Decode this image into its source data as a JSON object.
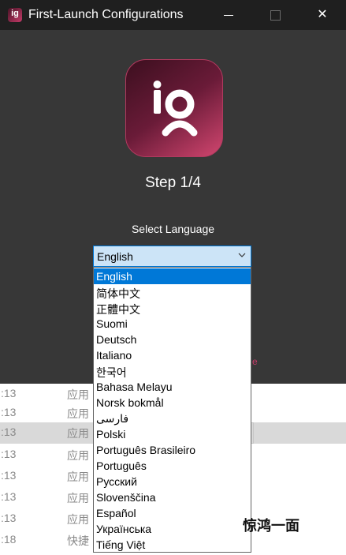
{
  "window": {
    "title": "First-Launch Configurations",
    "app_icon_text": "ig",
    "controls": {
      "minimize": "",
      "maximize": "",
      "close": "✕"
    }
  },
  "logo": {
    "text": "ig",
    "gradient": [
      "#3c0f1f",
      "#d1466f"
    ]
  },
  "step_text": "Step 1/4",
  "select_language_label": "Select Language",
  "language_select": {
    "value": "English",
    "options": [
      "English",
      "简体中文",
      "正體中文",
      "Suomi",
      "Deutsch",
      "Italiano",
      "한국어",
      "Bahasa Melayu",
      "Norsk bokmål",
      "فارسی",
      "Polski",
      "Português Brasileiro",
      "Português",
      "Русский",
      "Slovenščina",
      "Español",
      "Українська",
      "Tiếng Việt"
    ],
    "highlighted_index": 0
  },
  "background_rows": [
    {
      "time": ":13",
      "name": "应用"
    },
    {
      "time": ":13",
      "name": "应用"
    },
    {
      "time": ":13",
      "name": "应用"
    },
    {
      "time": ":13",
      "name": "应用"
    },
    {
      "time": ":13",
      "name": "应用"
    },
    {
      "time": ":13",
      "name": "应用"
    },
    {
      "time": ":13",
      "name": "应用"
    },
    {
      "time": ":18",
      "name": "快捷"
    }
  ],
  "watermark": "惊鸿一面",
  "colors": {
    "accent": "#0078d7",
    "brand": "#c43b69",
    "dialog_bg": "#373737",
    "titlebar_bg": "#1f1f1f"
  }
}
